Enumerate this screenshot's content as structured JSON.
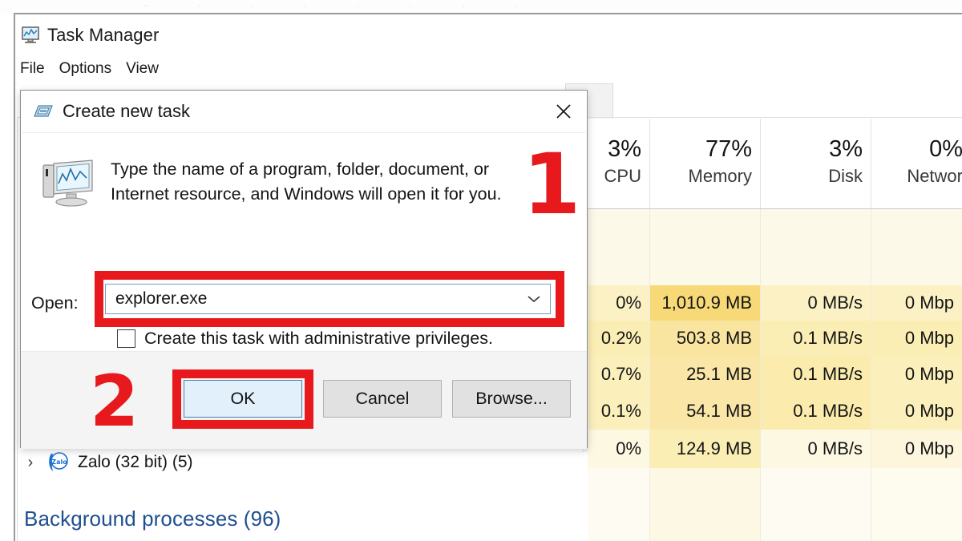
{
  "window": {
    "title": "Task Manager",
    "icon": "task-manager-icon",
    "menus": [
      "File",
      "Options",
      "View"
    ],
    "active_tab_fragment": "s"
  },
  "columns": [
    {
      "percent": "3%",
      "name": "CPU"
    },
    {
      "percent": "77%",
      "name": "Memory"
    },
    {
      "percent": "3%",
      "name": "Disk"
    },
    {
      "percent": "0%",
      "name": "Networ"
    }
  ],
  "rows": [
    {
      "cpu": "",
      "memory": "",
      "disk": "",
      "network": ""
    },
    {
      "cpu": "0%",
      "memory": "1,010.9 MB",
      "disk": "0 MB/s",
      "network": "0 Mbp"
    },
    {
      "cpu": "0.2%",
      "memory": "503.8 MB",
      "disk": "0.1 MB/s",
      "network": "0 Mbp"
    },
    {
      "cpu": "0.7%",
      "memory": "25.1 MB",
      "disk": "0.1 MB/s",
      "network": "0 Mbp"
    },
    {
      "cpu": "0.1%",
      "memory": "54.1 MB",
      "disk": "0.1 MB/s",
      "network": "0 Mbp"
    },
    {
      "cpu": "0%",
      "memory": "124.9 MB",
      "disk": "0 MB/s",
      "network": "0 Mbp"
    }
  ],
  "process_list": {
    "zalo_row": {
      "expander": "›",
      "icon": "zalo-icon",
      "label": "Zalo (32 bit) (5)"
    },
    "background_heading": "Background processes (96)"
  },
  "dialog": {
    "title": "Create new task",
    "title_icon": "new-task-icon",
    "close_icon": "close-icon",
    "body_icon": "computer-monitor-icon",
    "description": "Type the name of a program, folder, document, or Internet resource, and Windows will open it for you.",
    "open_label": "Open:",
    "open_value": "explorer.exe",
    "open_placeholder": "explorer.exe",
    "dropdown_icon": "chevron-down-icon",
    "checkbox_label": "Create this task with administrative privileges.",
    "checkbox_checked": false,
    "buttons": {
      "ok": "OK",
      "cancel": "Cancel",
      "browse": "Browse..."
    }
  },
  "annotations": {
    "step_one": "1",
    "step_two": "2",
    "highlight_color": "#e8191c"
  },
  "colors": {
    "accent_blue": "#1e4f8f",
    "ok_button_fill": "#e2f0fb",
    "ok_button_border": "#4b7fa8",
    "heat_light": "#fdf6dc",
    "heat_mid": "#faeeb6",
    "heat_strong": "#f9dd83",
    "window_chrome": "#ffffff"
  }
}
